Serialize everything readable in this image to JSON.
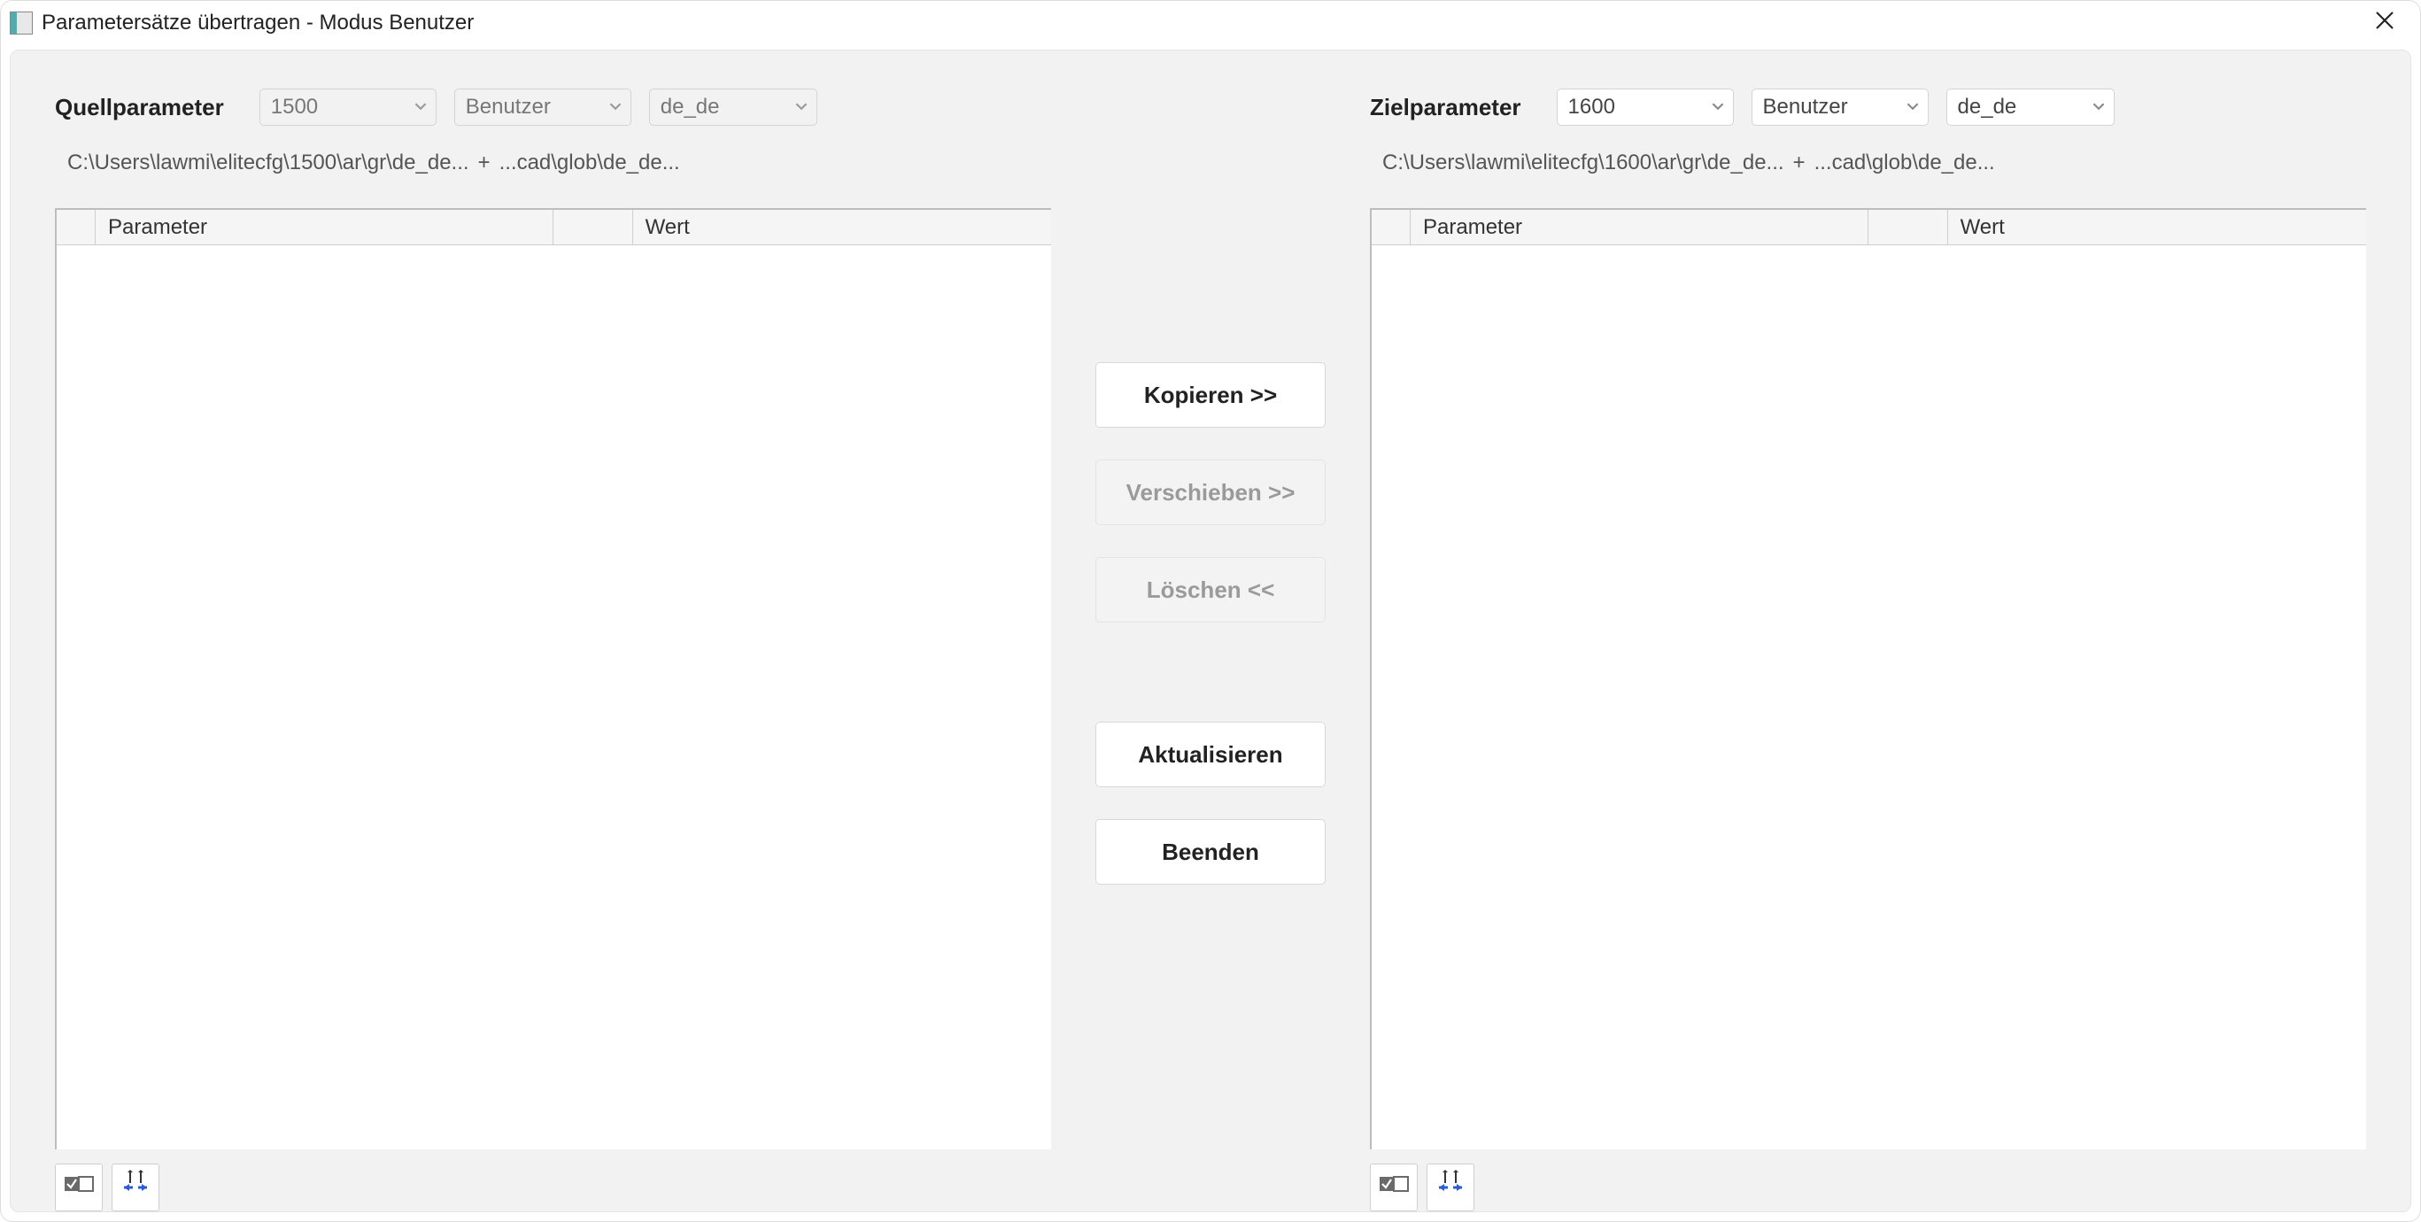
{
  "window": {
    "title": "Parametersätze übertragen - Modus Benutzer"
  },
  "source": {
    "label": "Quellparameter",
    "version_select": "1500",
    "mode_select": "Benutzer",
    "lang_select": "de_de",
    "path_main": "C:\\Users\\lawmi\\elitecfg\\1500\\ar\\gr\\de_de...",
    "path_join": "+",
    "path_extra": "...cad\\glob\\de_de...",
    "columns": {
      "parameter": "Parameter",
      "wert": "Wert"
    },
    "rows": []
  },
  "target": {
    "label": "Zielparameter",
    "version_select": "1600",
    "mode_select": "Benutzer",
    "lang_select": "de_de",
    "path_main": "C:\\Users\\lawmi\\elitecfg\\1600\\ar\\gr\\de_de...",
    "path_join": "+",
    "path_extra": "...cad\\glob\\de_de...",
    "columns": {
      "parameter": "Parameter",
      "wert": "Wert"
    },
    "rows": []
  },
  "actions": {
    "copy": "Kopieren >>",
    "move": "Verschieben >>",
    "delete": "Löschen <<",
    "refresh": "Aktualisieren",
    "exit": "Beenden"
  }
}
